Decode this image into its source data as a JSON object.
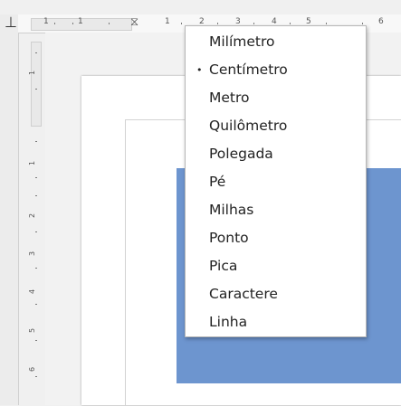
{
  "ruler": {
    "horizontal_numbers": [
      "1",
      "1",
      "1",
      "2",
      "3",
      "4",
      "5",
      "6"
    ],
    "vertical_numbers": [
      "1",
      "1",
      "2",
      "3",
      "4",
      "5",
      "6"
    ]
  },
  "units_menu": {
    "items": [
      {
        "label": "Milímetro",
        "selected": false
      },
      {
        "label": "Centímetro",
        "selected": true
      },
      {
        "label": "Metro",
        "selected": false
      },
      {
        "label": "Quilômetro",
        "selected": false
      },
      {
        "label": "Polegada",
        "selected": false
      },
      {
        "label": "Pé",
        "selected": false
      },
      {
        "label": "Milhas",
        "selected": false
      },
      {
        "label": "Ponto",
        "selected": false
      },
      {
        "label": "Pica",
        "selected": false
      },
      {
        "label": "Caractere",
        "selected": false
      },
      {
        "label": "Linha",
        "selected": false
      }
    ],
    "bullet": "•"
  },
  "colors": {
    "shape_fill": "#6d95cf",
    "menu_bg": "#ffffff"
  }
}
